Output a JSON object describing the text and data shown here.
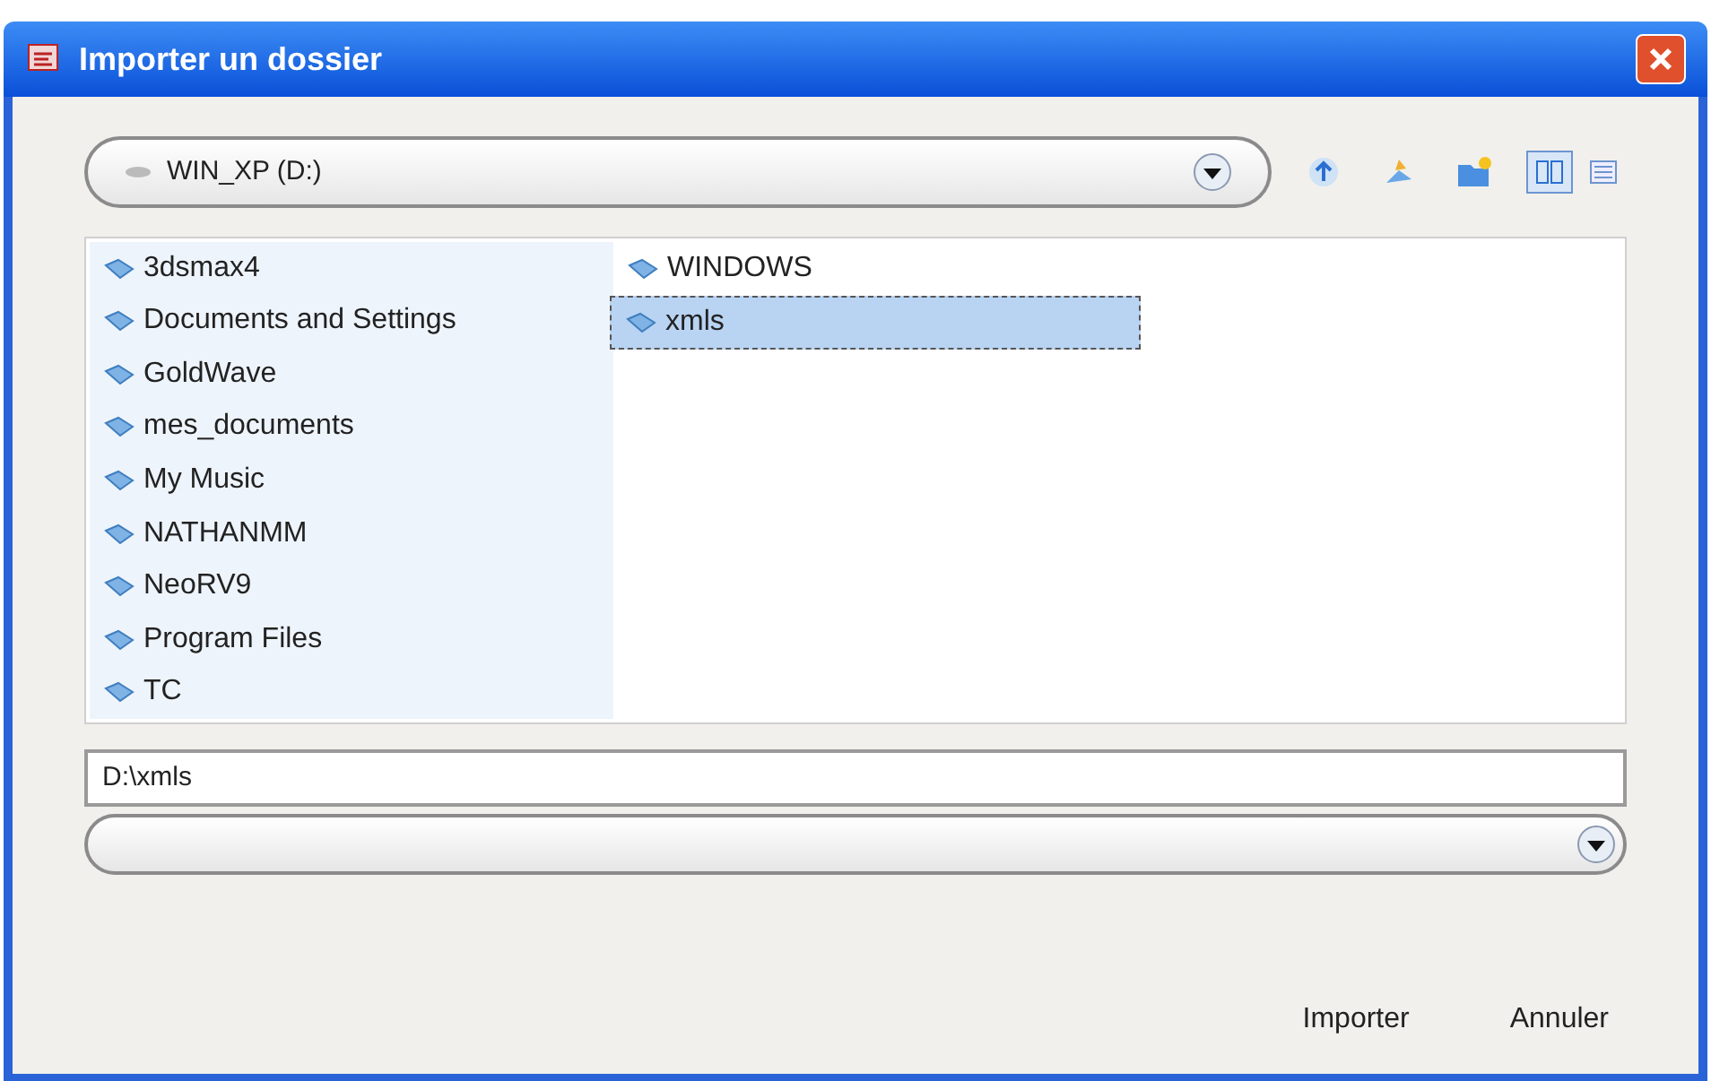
{
  "window": {
    "title": "Importer un dossier"
  },
  "location": {
    "value": "WIN_XP (D:)"
  },
  "folders": [
    [
      {
        "name": "3dsmax4",
        "selected": false
      },
      {
        "name": "Documents and Settings",
        "selected": false
      },
      {
        "name": "GoldWave",
        "selected": false
      },
      {
        "name": "mes_documents",
        "selected": false
      },
      {
        "name": "My Music",
        "selected": false
      },
      {
        "name": "NATHANMM",
        "selected": false
      },
      {
        "name": "NeoRV9",
        "selected": false
      },
      {
        "name": "Program Files",
        "selected": false
      },
      {
        "name": "TC",
        "selected": false
      }
    ],
    [
      {
        "name": "WINDOWS",
        "selected": false
      },
      {
        "name": "xmls",
        "selected": true
      }
    ]
  ],
  "path_field": {
    "value": "D:\\xmls"
  },
  "buttons": [
    "Importer",
    "Annuler"
  ]
}
